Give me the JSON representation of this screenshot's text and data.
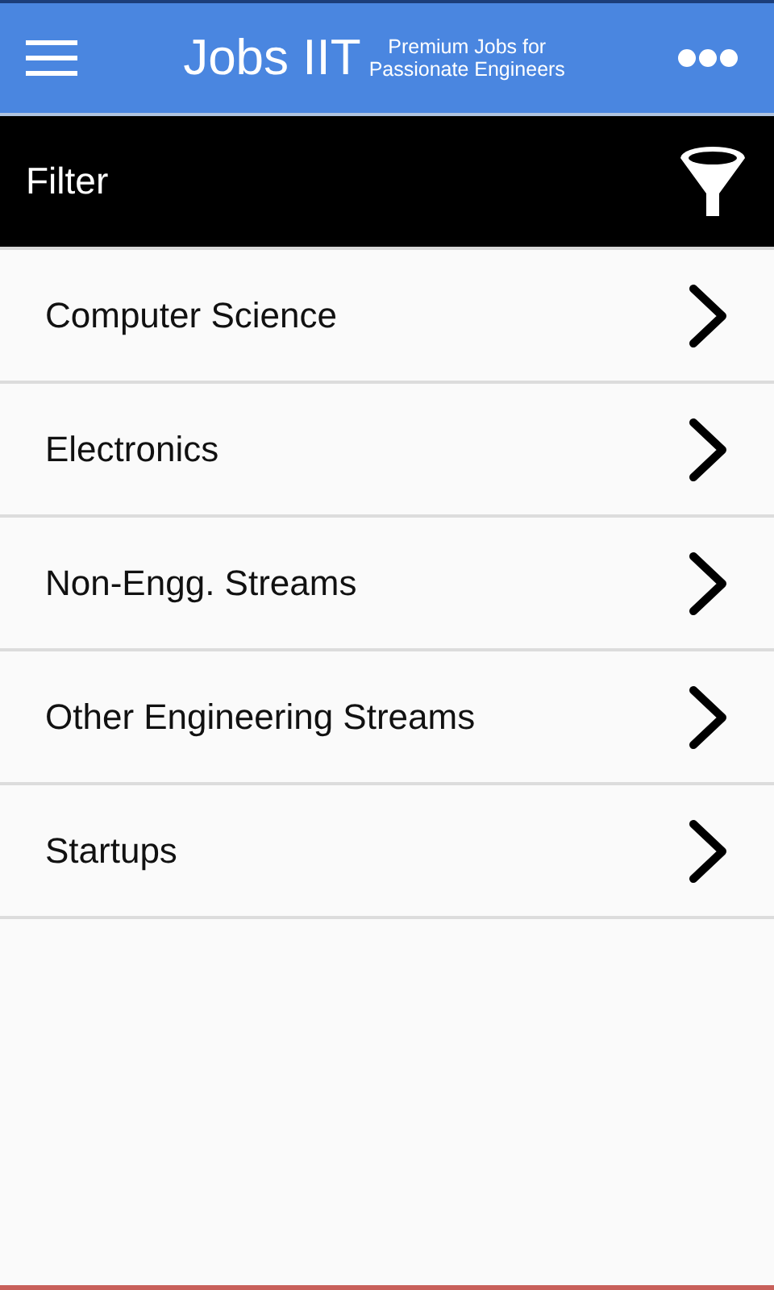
{
  "app_bar": {
    "title": "Jobs IIT",
    "tagline": [
      "Premium Jobs for",
      "Passionate Engineers"
    ]
  },
  "filter_bar": {
    "title": "Filter"
  },
  "categories": [
    {
      "label": "Computer Science"
    },
    {
      "label": "Electronics"
    },
    {
      "label": "Non-Engg. Streams"
    },
    {
      "label": "Other Engineering Streams"
    },
    {
      "label": "Startups"
    }
  ]
}
